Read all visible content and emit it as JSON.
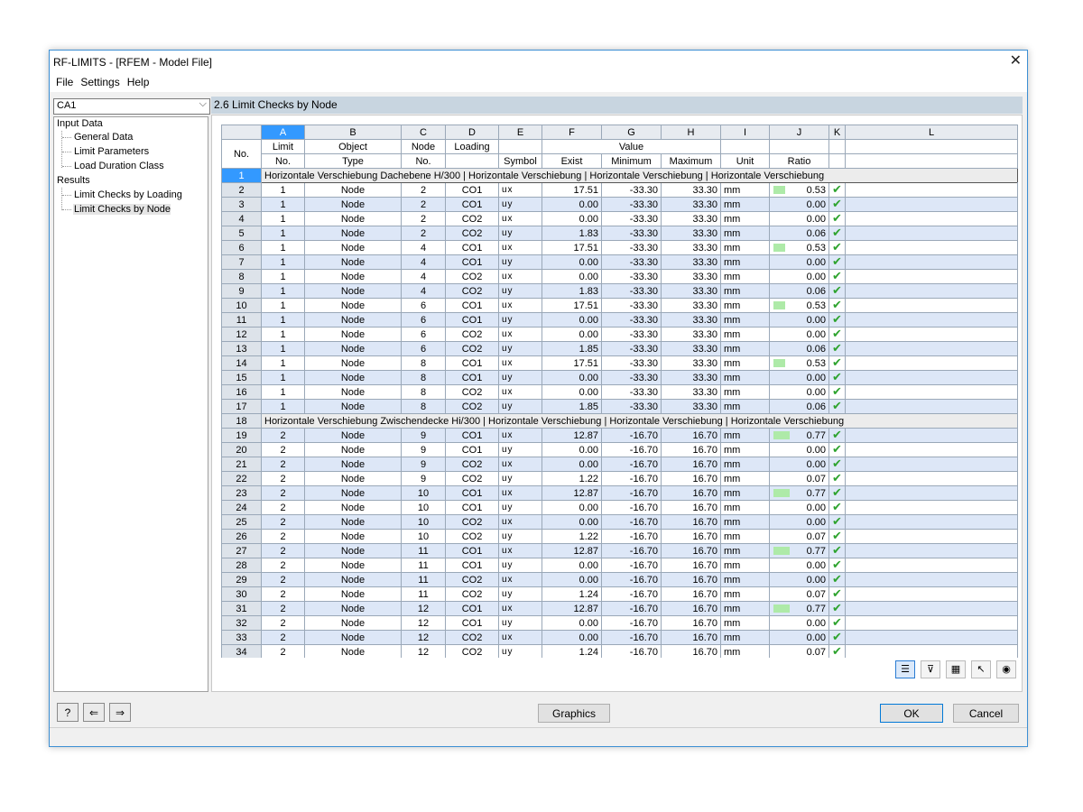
{
  "window": {
    "title": "RF-LIMITS - [RFEM - Model File]"
  },
  "menu": [
    "File",
    "Settings",
    "Help"
  ],
  "case_select": {
    "value": "CA1"
  },
  "tree": {
    "input_data": "Input Data",
    "input_items": [
      "General Data",
      "Limit Parameters",
      "Load Duration Class"
    ],
    "results": "Results",
    "result_items": [
      "Limit Checks by Loading",
      "Limit Checks by Node"
    ]
  },
  "panel": {
    "title": "2.6 Limit Checks by Node"
  },
  "columns": {
    "letters": [
      "A",
      "B",
      "C",
      "D",
      "E",
      "F",
      "G",
      "H",
      "I",
      "J",
      "K",
      "L"
    ],
    "no": "No.",
    "limit_1": "Limit",
    "limit_2": "No.",
    "object_1": "Object",
    "object_2": "Type",
    "node_1": "Node",
    "node_2": "No.",
    "loading": "Loading",
    "symbol": "Symbol",
    "value": "Value",
    "exist": "Exist",
    "minimum": "Minimum",
    "maximum": "Maximum",
    "unit": "Unit",
    "ratio": "Ratio"
  },
  "groups": [
    "Horizontale Verschiebung Dachebene H/300 | Horizontale Verschiebung | Horizontale Verschiebung | Horizontale Verschiebung",
    "Horizontale Verschiebung Zwischendecke Hi/300 | Horizontale Verschiebung | Horizontale Verschiebung | Horizontale Verschiebung"
  ],
  "rows": [
    {
      "no": "2",
      "limit": "1",
      "type": "Node",
      "node": "2",
      "loading": "CO1",
      "symbol": "ux",
      "exist": "17.51",
      "min": "-33.30",
      "max": "33.30",
      "unit": "mm",
      "ratio": "0.53",
      "ratio_value": 0.53
    },
    {
      "no": "3",
      "limit": "1",
      "type": "Node",
      "node": "2",
      "loading": "CO1",
      "symbol": "uy",
      "exist": "0.00",
      "min": "-33.30",
      "max": "33.30",
      "unit": "mm",
      "ratio": "0.00",
      "ratio_value": 0
    },
    {
      "no": "4",
      "limit": "1",
      "type": "Node",
      "node": "2",
      "loading": "CO2",
      "symbol": "ux",
      "exist": "0.00",
      "min": "-33.30",
      "max": "33.30",
      "unit": "mm",
      "ratio": "0.00",
      "ratio_value": 0
    },
    {
      "no": "5",
      "limit": "1",
      "type": "Node",
      "node": "2",
      "loading": "CO2",
      "symbol": "uy",
      "exist": "1.83",
      "min": "-33.30",
      "max": "33.30",
      "unit": "mm",
      "ratio": "0.06",
      "ratio_value": 0.06
    },
    {
      "no": "6",
      "limit": "1",
      "type": "Node",
      "node": "4",
      "loading": "CO1",
      "symbol": "ux",
      "exist": "17.51",
      "min": "-33.30",
      "max": "33.30",
      "unit": "mm",
      "ratio": "0.53",
      "ratio_value": 0.53
    },
    {
      "no": "7",
      "limit": "1",
      "type": "Node",
      "node": "4",
      "loading": "CO1",
      "symbol": "uy",
      "exist": "0.00",
      "min": "-33.30",
      "max": "33.30",
      "unit": "mm",
      "ratio": "0.00",
      "ratio_value": 0
    },
    {
      "no": "8",
      "limit": "1",
      "type": "Node",
      "node": "4",
      "loading": "CO2",
      "symbol": "ux",
      "exist": "0.00",
      "min": "-33.30",
      "max": "33.30",
      "unit": "mm",
      "ratio": "0.00",
      "ratio_value": 0
    },
    {
      "no": "9",
      "limit": "1",
      "type": "Node",
      "node": "4",
      "loading": "CO2",
      "symbol": "uy",
      "exist": "1.83",
      "min": "-33.30",
      "max": "33.30",
      "unit": "mm",
      "ratio": "0.06",
      "ratio_value": 0.06
    },
    {
      "no": "10",
      "limit": "1",
      "type": "Node",
      "node": "6",
      "loading": "CO1",
      "symbol": "ux",
      "exist": "17.51",
      "min": "-33.30",
      "max": "33.30",
      "unit": "mm",
      "ratio": "0.53",
      "ratio_value": 0.53
    },
    {
      "no": "11",
      "limit": "1",
      "type": "Node",
      "node": "6",
      "loading": "CO1",
      "symbol": "uy",
      "exist": "0.00",
      "min": "-33.30",
      "max": "33.30",
      "unit": "mm",
      "ratio": "0.00",
      "ratio_value": 0
    },
    {
      "no": "12",
      "limit": "1",
      "type": "Node",
      "node": "6",
      "loading": "CO2",
      "symbol": "ux",
      "exist": "0.00",
      "min": "-33.30",
      "max": "33.30",
      "unit": "mm",
      "ratio": "0.00",
      "ratio_value": 0
    },
    {
      "no": "13",
      "limit": "1",
      "type": "Node",
      "node": "6",
      "loading": "CO2",
      "symbol": "uy",
      "exist": "1.85",
      "min": "-33.30",
      "max": "33.30",
      "unit": "mm",
      "ratio": "0.06",
      "ratio_value": 0.06
    },
    {
      "no": "14",
      "limit": "1",
      "type": "Node",
      "node": "8",
      "loading": "CO1",
      "symbol": "ux",
      "exist": "17.51",
      "min": "-33.30",
      "max": "33.30",
      "unit": "mm",
      "ratio": "0.53",
      "ratio_value": 0.53
    },
    {
      "no": "15",
      "limit": "1",
      "type": "Node",
      "node": "8",
      "loading": "CO1",
      "symbol": "uy",
      "exist": "0.00",
      "min": "-33.30",
      "max": "33.30",
      "unit": "mm",
      "ratio": "0.00",
      "ratio_value": 0
    },
    {
      "no": "16",
      "limit": "1",
      "type": "Node",
      "node": "8",
      "loading": "CO2",
      "symbol": "ux",
      "exist": "0.00",
      "min": "-33.30",
      "max": "33.30",
      "unit": "mm",
      "ratio": "0.00",
      "ratio_value": 0
    },
    {
      "no": "17",
      "limit": "1",
      "type": "Node",
      "node": "8",
      "loading": "CO2",
      "symbol": "uy",
      "exist": "1.85",
      "min": "-33.30",
      "max": "33.30",
      "unit": "mm",
      "ratio": "0.06",
      "ratio_value": 0.06
    },
    {
      "no": "19",
      "limit": "2",
      "type": "Node",
      "node": "9",
      "loading": "CO1",
      "symbol": "ux",
      "exist": "12.87",
      "min": "-16.70",
      "max": "16.70",
      "unit": "mm",
      "ratio": "0.77",
      "ratio_value": 0.77
    },
    {
      "no": "20",
      "limit": "2",
      "type": "Node",
      "node": "9",
      "loading": "CO1",
      "symbol": "uy",
      "exist": "0.00",
      "min": "-16.70",
      "max": "16.70",
      "unit": "mm",
      "ratio": "0.00",
      "ratio_value": 0
    },
    {
      "no": "21",
      "limit": "2",
      "type": "Node",
      "node": "9",
      "loading": "CO2",
      "symbol": "ux",
      "exist": "0.00",
      "min": "-16.70",
      "max": "16.70",
      "unit": "mm",
      "ratio": "0.00",
      "ratio_value": 0
    },
    {
      "no": "22",
      "limit": "2",
      "type": "Node",
      "node": "9",
      "loading": "CO2",
      "symbol": "uy",
      "exist": "1.22",
      "min": "-16.70",
      "max": "16.70",
      "unit": "mm",
      "ratio": "0.07",
      "ratio_value": 0.07
    },
    {
      "no": "23",
      "limit": "2",
      "type": "Node",
      "node": "10",
      "loading": "CO1",
      "symbol": "ux",
      "exist": "12.87",
      "min": "-16.70",
      "max": "16.70",
      "unit": "mm",
      "ratio": "0.77",
      "ratio_value": 0.77
    },
    {
      "no": "24",
      "limit": "2",
      "type": "Node",
      "node": "10",
      "loading": "CO1",
      "symbol": "uy",
      "exist": "0.00",
      "min": "-16.70",
      "max": "16.70",
      "unit": "mm",
      "ratio": "0.00",
      "ratio_value": 0
    },
    {
      "no": "25",
      "limit": "2",
      "type": "Node",
      "node": "10",
      "loading": "CO2",
      "symbol": "ux",
      "exist": "0.00",
      "min": "-16.70",
      "max": "16.70",
      "unit": "mm",
      "ratio": "0.00",
      "ratio_value": 0
    },
    {
      "no": "26",
      "limit": "2",
      "type": "Node",
      "node": "10",
      "loading": "CO2",
      "symbol": "uy",
      "exist": "1.22",
      "min": "-16.70",
      "max": "16.70",
      "unit": "mm",
      "ratio": "0.07",
      "ratio_value": 0.07
    },
    {
      "no": "27",
      "limit": "2",
      "type": "Node",
      "node": "11",
      "loading": "CO1",
      "symbol": "ux",
      "exist": "12.87",
      "min": "-16.70",
      "max": "16.70",
      "unit": "mm",
      "ratio": "0.77",
      "ratio_value": 0.77
    },
    {
      "no": "28",
      "limit": "2",
      "type": "Node",
      "node": "11",
      "loading": "CO1",
      "symbol": "uy",
      "exist": "0.00",
      "min": "-16.70",
      "max": "16.70",
      "unit": "mm",
      "ratio": "0.00",
      "ratio_value": 0
    },
    {
      "no": "29",
      "limit": "2",
      "type": "Node",
      "node": "11",
      "loading": "CO2",
      "symbol": "ux",
      "exist": "0.00",
      "min": "-16.70",
      "max": "16.70",
      "unit": "mm",
      "ratio": "0.00",
      "ratio_value": 0
    },
    {
      "no": "30",
      "limit": "2",
      "type": "Node",
      "node": "11",
      "loading": "CO2",
      "symbol": "uy",
      "exist": "1.24",
      "min": "-16.70",
      "max": "16.70",
      "unit": "mm",
      "ratio": "0.07",
      "ratio_value": 0.07
    },
    {
      "no": "31",
      "limit": "2",
      "type": "Node",
      "node": "12",
      "loading": "CO1",
      "symbol": "ux",
      "exist": "12.87",
      "min": "-16.70",
      "max": "16.70",
      "unit": "mm",
      "ratio": "0.77",
      "ratio_value": 0.77
    },
    {
      "no": "32",
      "limit": "2",
      "type": "Node",
      "node": "12",
      "loading": "CO1",
      "symbol": "uy",
      "exist": "0.00",
      "min": "-16.70",
      "max": "16.70",
      "unit": "mm",
      "ratio": "0.00",
      "ratio_value": 0
    },
    {
      "no": "33",
      "limit": "2",
      "type": "Node",
      "node": "12",
      "loading": "CO2",
      "symbol": "ux",
      "exist": "0.00",
      "min": "-16.70",
      "max": "16.70",
      "unit": "mm",
      "ratio": "0.00",
      "ratio_value": 0
    },
    {
      "no": "34",
      "limit": "2",
      "type": "Node",
      "node": "12",
      "loading": "CO2",
      "symbol": "uy",
      "exist": "1.24",
      "min": "-16.70",
      "max": "16.70",
      "unit": "mm",
      "ratio": "0.07",
      "ratio_value": 0.07
    }
  ],
  "group_row_numbers": [
    "1",
    "18"
  ],
  "icons": {
    "check": "check-icon",
    "toolbar": [
      "excel-export-icon",
      "filter-icon",
      "excel-icon",
      "select-icon",
      "view-icon"
    ],
    "bottom_left": [
      "help-icon",
      "back-icon",
      "forward-icon"
    ]
  },
  "colors": {
    "selected": "#3399ff",
    "ratio_bar": "#aeeaa8",
    "row_alt": "#dde7f7",
    "check": "#2ea32e"
  },
  "buttons": {
    "graphics": "Graphics",
    "ok": "OK",
    "cancel": "Cancel"
  }
}
